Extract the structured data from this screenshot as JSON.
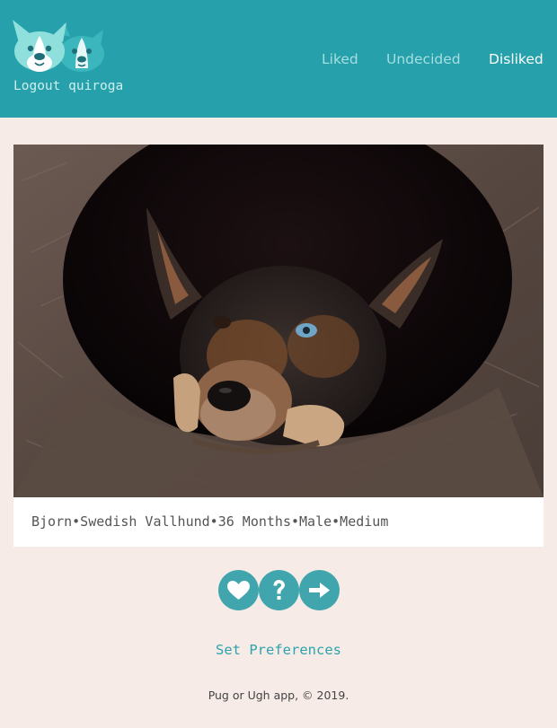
{
  "header": {
    "logo_icon": "corgi-dogs-logo-icon",
    "logout_label": "Logout quiroga",
    "nav": {
      "liked": "Liked",
      "undecided": "Undecided",
      "disliked": "Disliked"
    },
    "colors": {
      "background": "#26a0aa",
      "active": "#ffffff",
      "inactive": "#a6dfe2"
    }
  },
  "dog": {
    "name": "Bjorn",
    "breed": "Swedish Vallhund",
    "age": "36 Months",
    "sex": "Male",
    "size": "Medium",
    "info_line": "Bjorn•Swedish Vallhund•36 Months•Male•Medium"
  },
  "actions": [
    {
      "name": "like",
      "icon": "heart-icon"
    },
    {
      "name": "undecided",
      "icon": "question-icon"
    },
    {
      "name": "skip",
      "icon": "arrow-right-icon"
    }
  ],
  "preferences_label": "Set Preferences",
  "footer": "Pug or Ugh app, © 2019.",
  "colors": {
    "page": "#f6ebe6",
    "accent": "#40a5ad"
  }
}
